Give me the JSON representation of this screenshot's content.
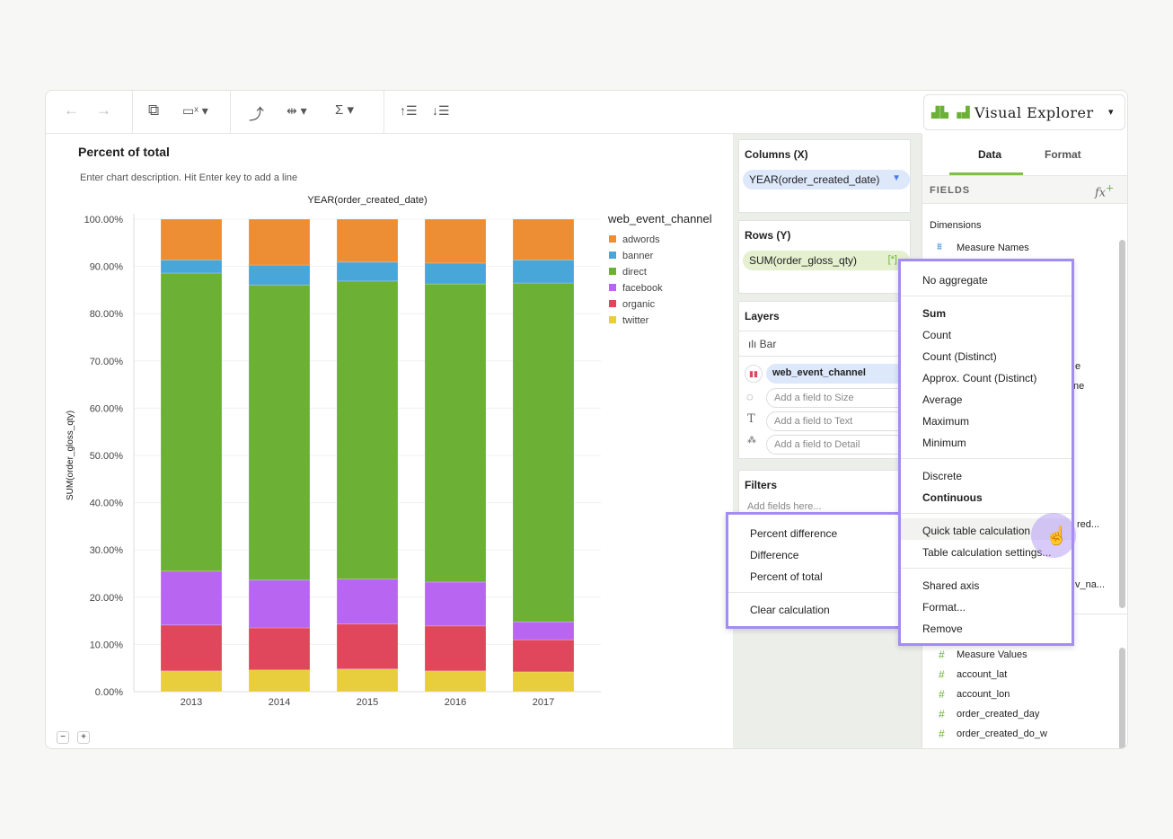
{
  "toolbar": {
    "icons": [
      "back-arrow",
      "forward-arrow",
      "duplicate",
      "clear-chart",
      "swap-axes",
      "fit",
      "aggregate",
      "sort-ascending",
      "sort-descending"
    ],
    "brand": "Visual Explorer"
  },
  "chart": {
    "title": "Percent of total",
    "description": "Enter chart description. Hit Enter key to add a line"
  },
  "chart_data": {
    "type": "bar",
    "stacked": true,
    "title": "",
    "xlabel": "YEAR(order_created_date)",
    "ylabel": "SUM(order_gloss_qty)",
    "ylim": [
      0,
      100
    ],
    "yticks": [
      "0.00%",
      "10.00%",
      "20.00%",
      "30.00%",
      "40.00%",
      "50.00%",
      "60.00%",
      "70.00%",
      "80.00%",
      "90.00%",
      "100.00%"
    ],
    "categories": [
      "2013",
      "2014",
      "2015",
      "2016",
      "2017"
    ],
    "legend_title": "web_event_channel",
    "legend_position": "right",
    "grid": true,
    "series": [
      {
        "name": "twitter",
        "color": "#e8cd3c",
        "values": [
          4.4,
          4.6,
          4.8,
          4.4,
          4.2
        ]
      },
      {
        "name": "organic",
        "color": "#e0475d",
        "values": [
          9.7,
          8.9,
          9.5,
          9.5,
          6.8
        ]
      },
      {
        "name": "facebook",
        "color": "#b866f2",
        "values": [
          11.4,
          10.1,
          9.5,
          9.3,
          3.8
        ]
      },
      {
        "name": "direct",
        "color": "#6cb136",
        "values": [
          63.1,
          62.5,
          63.1,
          63.1,
          71.7
        ]
      },
      {
        "name": "banner",
        "color": "#48a6d9",
        "values": [
          2.8,
          4.2,
          4.0,
          4.4,
          4.9
        ]
      },
      {
        "name": "adwords",
        "color": "#ed8d34",
        "values": [
          8.6,
          9.7,
          9.1,
          9.3,
          8.6
        ]
      }
    ]
  },
  "legend": [
    "adwords",
    "banner",
    "direct",
    "facebook",
    "organic",
    "twitter"
  ],
  "shelves": {
    "columns_title": "Columns (X)",
    "columns_pill": "YEAR(order_created_date)",
    "rows_title": "Rows (Y)",
    "rows_pill": "SUM(order_gloss_qty)",
    "rows_badge": "[*]",
    "layers_title": "Layers",
    "mark": "Bar",
    "color_field": "web_event_channel",
    "size_ph": "Add a field to Size",
    "text_ph": "Add a field to Text",
    "detail_ph": "Add a field to Detail",
    "filters_title": "Filters",
    "filters_ph": "Add fields here..."
  },
  "panel": {
    "tabs": [
      "Data",
      "Format"
    ],
    "fields": "FIELDS",
    "dimensions": "Dimensions",
    "dims": [
      "Measure Names"
    ],
    "peek": [
      "e",
      "ne",
      "red...",
      "v_na..."
    ],
    "measures": [
      "Measure Values",
      "account_lat",
      "account_lon",
      "order_created_day",
      "order_created_do_w"
    ]
  },
  "menu": {
    "items": [
      "No aggregate",
      "Sum",
      "Count",
      "Count (Distinct)",
      "Approx. Count (Distinct)",
      "Average",
      "Maximum",
      "Minimum",
      "Discrete",
      "Continuous",
      "Quick table calculation",
      "Table calculation settings...",
      "Shared axis",
      "Format...",
      "Remove"
    ]
  },
  "submenu": {
    "items": [
      "Percent difference",
      "Difference",
      "Percent of total",
      "Clear calculation"
    ]
  },
  "zoom": {
    "minus": "−",
    "plus": "+"
  }
}
